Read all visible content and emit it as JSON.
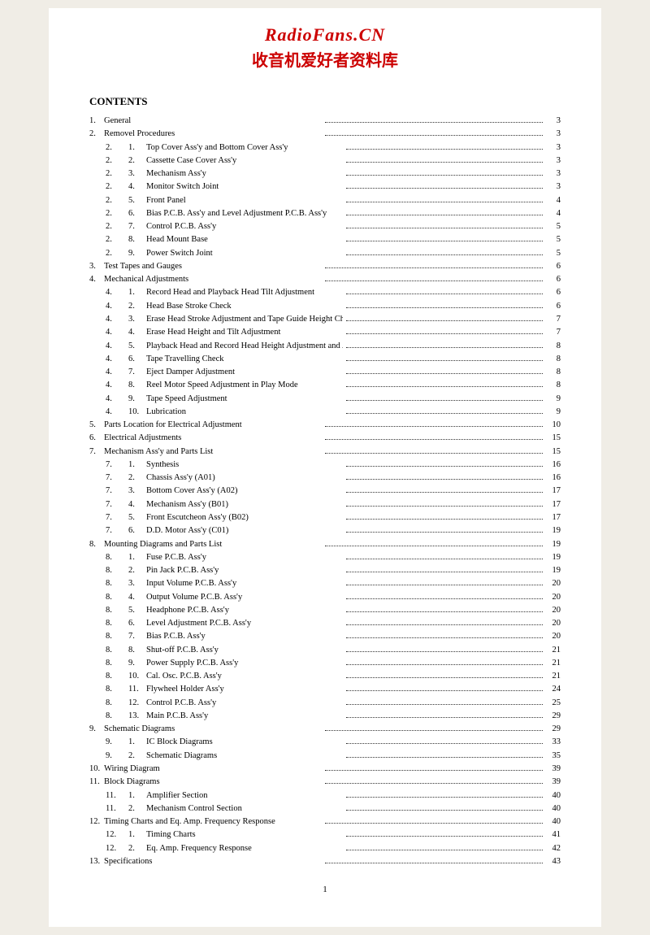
{
  "header": {
    "title": "RadioFans.CN",
    "subtitle": "收音机爱好者资料库"
  },
  "contents_label": "CONTENTS",
  "entries": [
    {
      "level": 0,
      "num": "1.",
      "sub": "",
      "label": "General",
      "page": "3"
    },
    {
      "level": 0,
      "num": "2.",
      "sub": "",
      "label": "Removel Procedures",
      "page": "3"
    },
    {
      "level": 1,
      "num": "2.",
      "sub": "1.",
      "label": "Top Cover Ass'y and Bottom Cover Ass'y",
      "page": "3"
    },
    {
      "level": 1,
      "num": "2.",
      "sub": "2.",
      "label": "Cassette Case Cover Ass'y",
      "page": "3"
    },
    {
      "level": 1,
      "num": "2.",
      "sub": "3.",
      "label": "Mechanism Ass'y",
      "page": "3"
    },
    {
      "level": 1,
      "num": "2.",
      "sub": "4.",
      "label": "Monitor Switch Joint",
      "page": "3"
    },
    {
      "level": 1,
      "num": "2.",
      "sub": "5.",
      "label": "Front Panel",
      "page": "4"
    },
    {
      "level": 1,
      "num": "2.",
      "sub": "6.",
      "label": "Bias P.C.B. Ass'y and Level Adjustment P.C.B. Ass'y",
      "page": "4"
    },
    {
      "level": 1,
      "num": "2.",
      "sub": "7.",
      "label": "Control P.C.B. Ass'y",
      "page": "5"
    },
    {
      "level": 1,
      "num": "2.",
      "sub": "8.",
      "label": "Head Mount Base",
      "page": "5"
    },
    {
      "level": 1,
      "num": "2.",
      "sub": "9.",
      "label": "Power Switch Joint",
      "page": "5"
    },
    {
      "level": 0,
      "num": "3.",
      "sub": "",
      "label": "Test Tapes and Gauges",
      "page": "6"
    },
    {
      "level": 0,
      "num": "4.",
      "sub": "",
      "label": "Mechanical Adjustments",
      "page": "6"
    },
    {
      "level": 1,
      "num": "4.",
      "sub": "1.",
      "label": "Record Head and Playback Head Tilt Adjustment",
      "page": "6"
    },
    {
      "level": 1,
      "num": "4.",
      "sub": "2.",
      "label": "Head Base Stroke Check",
      "page": "6"
    },
    {
      "level": 1,
      "num": "4.",
      "sub": "3.",
      "label": "Erase Head Stroke Adjustment and Tape Guide Height Check",
      "page": "7"
    },
    {
      "level": 1,
      "num": "4.",
      "sub": "4.",
      "label": "Erase Head Height and Tilt Adjustment",
      "page": "7"
    },
    {
      "level": 1,
      "num": "4.",
      "sub": "5.",
      "label": "Playback Head and Record Head Height Adjustment and Azimuth Alignment",
      "page": "8"
    },
    {
      "level": 1,
      "num": "4.",
      "sub": "6.",
      "label": "Tape Travelling Check",
      "page": "8"
    },
    {
      "level": 1,
      "num": "4.",
      "sub": "7.",
      "label": "Eject Damper Adjustment",
      "page": "8"
    },
    {
      "level": 1,
      "num": "4.",
      "sub": "8.",
      "label": "Reel Motor Speed Adjustment in Play Mode",
      "page": "8"
    },
    {
      "level": 1,
      "num": "4.",
      "sub": "9.",
      "label": "Tape Speed Adjustment",
      "page": "9"
    },
    {
      "level": 1,
      "num": "4.",
      "sub": "10.",
      "label": "Lubrication",
      "page": "9"
    },
    {
      "level": 0,
      "num": "5.",
      "sub": "",
      "label": "Parts Location for Electrical Adjustment",
      "page": "10"
    },
    {
      "level": 0,
      "num": "6.",
      "sub": "",
      "label": "Electrical Adjustments",
      "page": "15"
    },
    {
      "level": 0,
      "num": "7.",
      "sub": "",
      "label": "Mechanism Ass'y and Parts List",
      "page": "15"
    },
    {
      "level": 1,
      "num": "7.",
      "sub": "1.",
      "label": "Synthesis",
      "page": "16"
    },
    {
      "level": 1,
      "num": "7.",
      "sub": "2.",
      "label": "Chassis Ass'y (A01)",
      "page": "16"
    },
    {
      "level": 1,
      "num": "7.",
      "sub": "3.",
      "label": "Bottom Cover Ass'y (A02)",
      "page": "17"
    },
    {
      "level": 1,
      "num": "7.",
      "sub": "4.",
      "label": "Mechanism Ass'y (B01)",
      "page": "17"
    },
    {
      "level": 1,
      "num": "7.",
      "sub": "5.",
      "label": "Front Escutcheon Ass'y (B02)",
      "page": "17"
    },
    {
      "level": 1,
      "num": "7.",
      "sub": "6.",
      "label": "D.D. Motor Ass'y (C01)",
      "page": "19"
    },
    {
      "level": 0,
      "num": "8.",
      "sub": "",
      "label": "Mounting Diagrams and Parts List",
      "page": "19"
    },
    {
      "level": 1,
      "num": "8.",
      "sub": "1.",
      "label": "Fuse P.C.B. Ass'y",
      "page": "19"
    },
    {
      "level": 1,
      "num": "8.",
      "sub": "2.",
      "label": "Pin Jack P.C.B. Ass'y",
      "page": "19"
    },
    {
      "level": 1,
      "num": "8.",
      "sub": "3.",
      "label": "Input Volume P.C.B. Ass'y",
      "page": "20"
    },
    {
      "level": 1,
      "num": "8.",
      "sub": "4.",
      "label": "Output Volume P.C.B. Ass'y",
      "page": "20"
    },
    {
      "level": 1,
      "num": "8.",
      "sub": "5.",
      "label": "Headphone P.C.B. Ass'y",
      "page": "20"
    },
    {
      "level": 1,
      "num": "8.",
      "sub": "6.",
      "label": "Level Adjustment P.C.B. Ass'y",
      "page": "20"
    },
    {
      "level": 1,
      "num": "8.",
      "sub": "7.",
      "label": "Bias P.C.B. Ass'y",
      "page": "20"
    },
    {
      "level": 1,
      "num": "8.",
      "sub": "8.",
      "label": "Shut-off P.C.B. Ass'y",
      "page": "21"
    },
    {
      "level": 1,
      "num": "8.",
      "sub": "9.",
      "label": "Power Supply P.C.B. Ass'y",
      "page": "21"
    },
    {
      "level": 1,
      "num": "8.",
      "sub": "10.",
      "label": "Cal. Osc. P.C.B. Ass'y",
      "page": "21"
    },
    {
      "level": 1,
      "num": "8.",
      "sub": "11.",
      "label": "Flywheel Holder Ass'y",
      "page": "24"
    },
    {
      "level": 1,
      "num": "8.",
      "sub": "12.",
      "label": "Control P.C.B. Ass'y",
      "page": "25"
    },
    {
      "level": 1,
      "num": "8.",
      "sub": "13.",
      "label": "Main P.C.B. Ass'y",
      "page": "29"
    },
    {
      "level": 0,
      "num": "9.",
      "sub": "",
      "label": "Schematic Diagrams",
      "page": "29"
    },
    {
      "level": 1,
      "num": "9.",
      "sub": "1.",
      "label": "IC Block Diagrams",
      "page": "33"
    },
    {
      "level": 1,
      "num": "9.",
      "sub": "2.",
      "label": "Schematic Diagrams",
      "page": "35"
    },
    {
      "level": 0,
      "num": "10.",
      "sub": "",
      "label": "Wiring Diagram",
      "page": "39"
    },
    {
      "level": 0,
      "num": "11.",
      "sub": "",
      "label": "Block Diagrams",
      "page": "39"
    },
    {
      "level": 1,
      "num": "11.",
      "sub": "1.",
      "label": "Amplifier Section",
      "page": "40"
    },
    {
      "level": 1,
      "num": "11.",
      "sub": "2.",
      "label": "Mechanism Control Section",
      "page": "40"
    },
    {
      "level": 0,
      "num": "12.",
      "sub": "",
      "label": "Timing Charts and Eq. Amp. Frequency Response",
      "page": "40"
    },
    {
      "level": 1,
      "num": "12.",
      "sub": "1.",
      "label": "Timing Charts",
      "page": "41"
    },
    {
      "level": 1,
      "num": "12.",
      "sub": "2.",
      "label": "Eq. Amp. Frequency Response",
      "page": "42"
    },
    {
      "level": 0,
      "num": "13.",
      "sub": "",
      "label": "Specifications",
      "page": "43"
    }
  ],
  "page_number": "1"
}
